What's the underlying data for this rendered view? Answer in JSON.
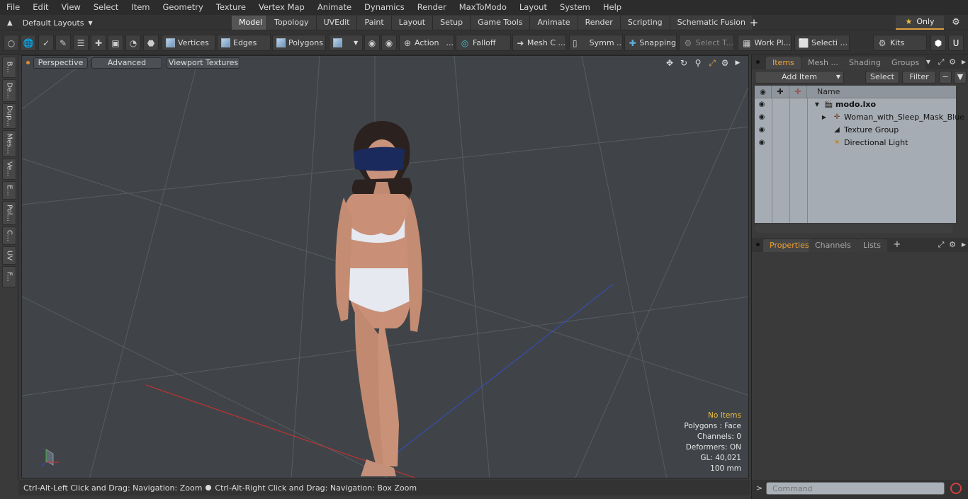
{
  "menu": [
    "File",
    "Edit",
    "View",
    "Select",
    "Item",
    "Geometry",
    "Texture",
    "Vertex Map",
    "Animate",
    "Dynamics",
    "Render",
    "MaxToModo",
    "Layout",
    "System",
    "Help"
  ],
  "layouts": {
    "label": "Default Layouts",
    "tabs": [
      "Model",
      "Topology",
      "UVEdit",
      "Paint",
      "Layout",
      "Setup",
      "Game Tools",
      "Animate",
      "Render",
      "Scripting",
      "Schematic Fusion"
    ],
    "active": "Model",
    "only_label": "Only"
  },
  "toolbar": {
    "vertices": "Vertices",
    "edges": "Edges",
    "polygons": "Polygons",
    "action": "Action",
    "falloff": "Falloff",
    "mesh_constraints": "Mesh C ...",
    "symmetry": "Symm ...",
    "snapping": "Snapping",
    "select_through": "Select T...",
    "work_plane": "Work Pl...",
    "selection": "Selecti ...",
    "kits": "Kits"
  },
  "left_tabs": [
    "B...",
    "De...",
    "Dup...",
    "Mes...",
    "Ve...",
    "E...",
    "Pol...",
    "C...",
    "UV",
    "F..."
  ],
  "viewport": {
    "view_label": "Perspective",
    "advanced_label": "Advanced",
    "textures_label": "Viewport Textures",
    "info": {
      "no_items": "No Items",
      "polygons": "Polygons : Face",
      "channels": "Channels: 0",
      "deformers": "Deformers: ON",
      "gl": "GL: 40,021",
      "scale": "100 mm"
    }
  },
  "status": {
    "hint1": "Ctrl-Alt-Left Click and Drag: Navigation: Zoom",
    "hint2": "Ctrl-Alt-Right Click and Drag: Navigation: Box Zoom"
  },
  "items_panel": {
    "tabs": [
      "Items",
      "Mesh ...",
      "Shading",
      "Groups"
    ],
    "add_item": "Add Item",
    "select": "Select",
    "filter": "Filter",
    "name_header": "Name",
    "items": [
      {
        "label": "modo.lxo",
        "icon": "scene-icon"
      },
      {
        "label": "Woman_with_Sleep_Mask_Blue",
        "icon": "mesh-icon"
      },
      {
        "label": "Texture Group",
        "icon": "texture-group-icon"
      },
      {
        "label": "Directional Light",
        "icon": "light-icon"
      }
    ]
  },
  "properties_panel": {
    "tabs": [
      "Properties",
      "Channels",
      "Lists"
    ]
  },
  "command": {
    "placeholder": "Command"
  },
  "colors": {
    "accent": "#f0a030",
    "viewport_bg": "#404448",
    "items_bg": "#a6acb3",
    "x_axis": "#d03030",
    "y_axis": "#40b040",
    "z_axis": "#3050c8"
  }
}
